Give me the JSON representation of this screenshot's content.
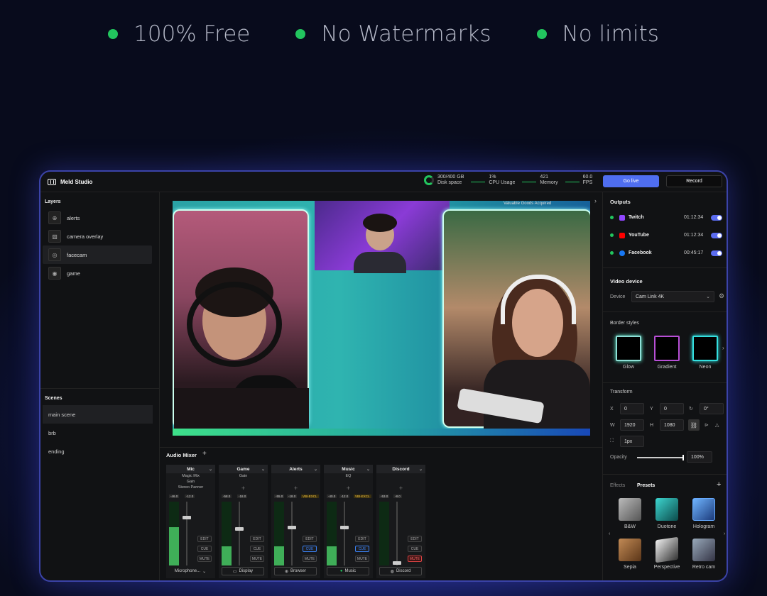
{
  "hero": {
    "items": [
      "100% Free",
      "No Watermarks",
      "No limits"
    ],
    "dot_color": "#22c55e"
  },
  "app": {
    "title": "Meld Studio",
    "stats": {
      "disk_value": "300/400 GB",
      "disk_label": "Disk space",
      "cpu_value": "1%",
      "cpu_label": "CPU Usage",
      "mem_value": "421",
      "mem_label": "Memory",
      "fps_value": "60.0",
      "fps_label": "FPS"
    },
    "go_live": "Go live",
    "record": "Record",
    "collapse_glyph": "›"
  },
  "layers": {
    "title": "Layers",
    "items": [
      {
        "label": "alerts",
        "icon": "globe-icon"
      },
      {
        "label": "camera overlay",
        "icon": "image-icon"
      },
      {
        "label": "facecam",
        "icon": "camera-icon"
      },
      {
        "label": "game",
        "icon": "capture-icon"
      }
    ],
    "selected": "facecam"
  },
  "scenes": {
    "title": "Scenes",
    "items": [
      "main scene",
      "brb",
      "ending"
    ],
    "selected": "main scene"
  },
  "preview": {
    "overlay_text": "Valuable Goods Acquired"
  },
  "mixer": {
    "title": "Audio Mixer",
    "add": "+",
    "channels": [
      {
        "name": "Mic",
        "effects": [
          "Magic Mix",
          "Gain",
          "Stereo Panner"
        ],
        "db": [
          "-46.0",
          "-12.0"
        ],
        "badge": "",
        "source": "Microphone...",
        "edit": "EDIT",
        "cue": "CUE",
        "mute": "MUTE",
        "cue_on": false,
        "mute_on": false,
        "level": 0.6
      },
      {
        "name": "Game",
        "effects": [
          "Gain"
        ],
        "db": [
          "-58.0",
          "-18.0"
        ],
        "badge": "",
        "source": "Display",
        "edit": "EDIT",
        "cue": "CUE",
        "mute": "MUTE",
        "cue_on": false,
        "mute_on": false,
        "level": 0.3
      },
      {
        "name": "Alerts",
        "effects": [],
        "db": [
          "-55.0",
          "-18.0"
        ],
        "badge": "VBI-EXCL",
        "source": "Browser",
        "edit": "EDIT",
        "cue": "CUE",
        "mute": "MUTE",
        "cue_on": true,
        "mute_on": false,
        "level": 0.3
      },
      {
        "name": "Music",
        "effects": [
          "EQ"
        ],
        "db": [
          "-40.0",
          "-12.0"
        ],
        "badge": "VBI-EXCL",
        "source": "Music",
        "edit": "EDIT",
        "cue": "CUE",
        "mute": "MUTE",
        "cue_on": true,
        "mute_on": false,
        "level": 0.3
      },
      {
        "name": "Discord",
        "effects": [],
        "db": [
          "-53.0",
          "-8.0"
        ],
        "badge": "",
        "source": "Discord",
        "edit": "EDIT",
        "cue": "CUE",
        "mute": "MUTE",
        "cue_on": false,
        "mute_on": true,
        "level": 0
      }
    ]
  },
  "outputs": {
    "title": "Outputs",
    "items": [
      {
        "platform": "Twitch",
        "time": "01:12:34",
        "color": "#9146ff"
      },
      {
        "platform": "YouTube",
        "time": "01:12:34",
        "color": "#ff0000"
      },
      {
        "platform": "Facebook",
        "time": "00:45:17",
        "color": "#1877f2"
      }
    ]
  },
  "video_device": {
    "title": "Video device",
    "label": "Device",
    "value": "Cam Link 4K"
  },
  "border_styles": {
    "title": "Border styles",
    "items": [
      "Glow",
      "Gradient",
      "Neon"
    ]
  },
  "transform": {
    "title": "Transform",
    "x_label": "X",
    "x": "0",
    "y_label": "Y",
    "y": "0",
    "rotation": "0°",
    "w_label": "W",
    "w": "1920",
    "h_label": "H",
    "h": "1080",
    "border": "1px",
    "opacity_label": "Opacity",
    "opacity": "100%",
    "opacity_level": 1.0
  },
  "effects": {
    "tab_effects": "Effects",
    "tab_presets": "Presets",
    "add": "+",
    "presets": [
      "B&W",
      "Duotone",
      "Hologram",
      "Sepia",
      "Perspective",
      "Retro cam"
    ]
  }
}
